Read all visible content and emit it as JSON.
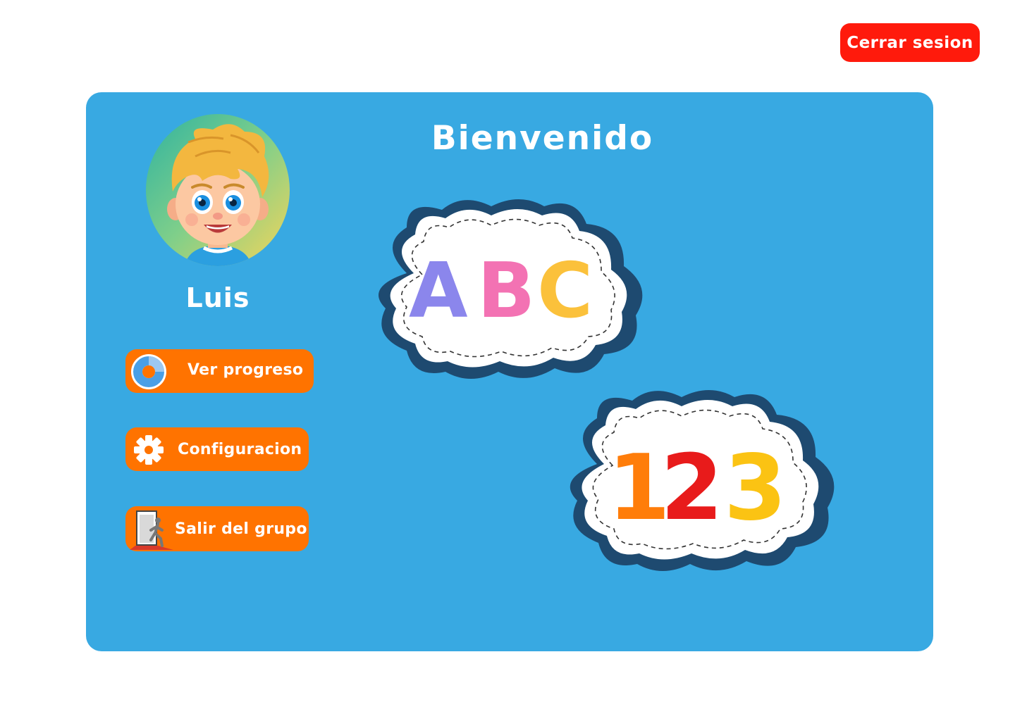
{
  "header": {
    "logout_label": "Cerrar sesion"
  },
  "main": {
    "title": "Bienvenido",
    "user": {
      "name": "Luis",
      "avatar_icon": "child-avatar-icon"
    },
    "menu": [
      {
        "label": "Ver progreso",
        "icon": "donut-chart-icon"
      },
      {
        "label": "Configuracion",
        "icon": "gear-icon"
      },
      {
        "label": "Salir del grupo",
        "icon": "exit-door-icon"
      }
    ],
    "cards": [
      {
        "text": "ABC",
        "letters": [
          "A",
          "B",
          "C"
        ]
      },
      {
        "text": "123",
        "letters": [
          "1",
          "2",
          "3"
        ]
      }
    ]
  },
  "colors": {
    "panel": "#38a9e2",
    "logout": "#ff1a0c",
    "menu_button": "#ff7300",
    "text": "#ffffff"
  }
}
